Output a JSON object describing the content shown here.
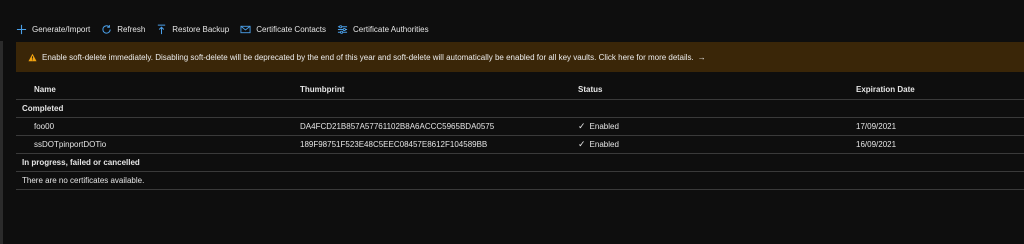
{
  "toolbar": {
    "generate_import": "Generate/Import",
    "refresh": "Refresh",
    "restore_backup": "Restore Backup",
    "certificate_contacts": "Certificate Contacts",
    "certificate_authorities": "Certificate Authorities"
  },
  "banner": {
    "text": "Enable soft-delete immediately. Disabling soft-delete will be deprecated by the end of this year and soft-delete will automatically be enabled for all key vaults. Click here for more details.",
    "arrow": "→"
  },
  "table": {
    "columns": {
      "name": "Name",
      "thumbprint": "Thumbprint",
      "status": "Status",
      "expiration": "Expiration Date"
    },
    "group_completed": "Completed",
    "rows": [
      {
        "name": "foo00",
        "thumbprint": "DA4FCD21B857A57761102B8A6ACCC5965BDA0575",
        "status": "Enabled",
        "expiration": "17/09/2021"
      },
      {
        "name": "ssDOTpinportDOTio",
        "thumbprint": "189F98751F523E48C5EEC08457E8612F104589BB",
        "status": "Enabled",
        "expiration": "16/09/2021"
      }
    ],
    "group_in_progress": "In progress, failed or cancelled",
    "empty_message": "There are no certificates available.",
    "check_glyph": "✓"
  },
  "colors": {
    "background": "#0e0e0e",
    "banner_bg": "#3a2608",
    "warning": "#f2a30f",
    "accent": "#4a9fe8"
  }
}
